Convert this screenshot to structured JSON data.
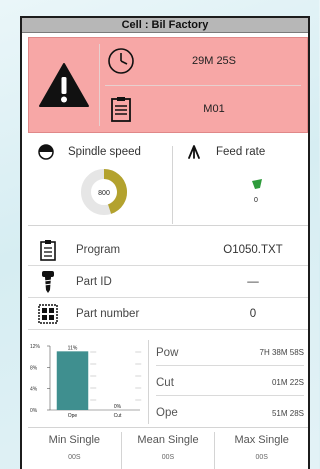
{
  "title": "Cell : Bil Factory",
  "alarm": {
    "time": "29M 25S",
    "program_code": "M01",
    "accent": "#f7a7a6"
  },
  "spindle": {
    "label": "Spindle speed",
    "value": "800",
    "fill_fraction": 0.45,
    "color": "#b3a22e"
  },
  "feed": {
    "label": "Feed rate",
    "value": "0",
    "color": "#2e9b3b"
  },
  "info": [
    {
      "icon": "clipboard-icon",
      "label": "Program",
      "value": "O1050.TXT"
    },
    {
      "icon": "screw-icon",
      "label": "Part ID",
      "value": "—"
    },
    {
      "icon": "grid-icon",
      "label": "Part number",
      "value": "0"
    }
  ],
  "chart_data": {
    "type": "bar",
    "categories": [
      "Ope",
      "Cut"
    ],
    "values": [
      11,
      0
    ],
    "data_labels": [
      "11%",
      "0%"
    ],
    "yticks": [
      "12%",
      "8%",
      "4%",
      "0%"
    ],
    "ylim": [
      0,
      12
    ],
    "color": "#3f8f8f"
  },
  "stats": [
    {
      "label": "Pow",
      "value": "7H 38M 58S"
    },
    {
      "label": "Cut",
      "value": "01M 22S"
    },
    {
      "label": "Ope",
      "value": "51M 28S"
    }
  ],
  "singles": [
    {
      "label": "Min Single",
      "value": "00S"
    },
    {
      "label": "Mean Single",
      "value": "00S"
    },
    {
      "label": "Max Single",
      "value": "00S"
    }
  ]
}
